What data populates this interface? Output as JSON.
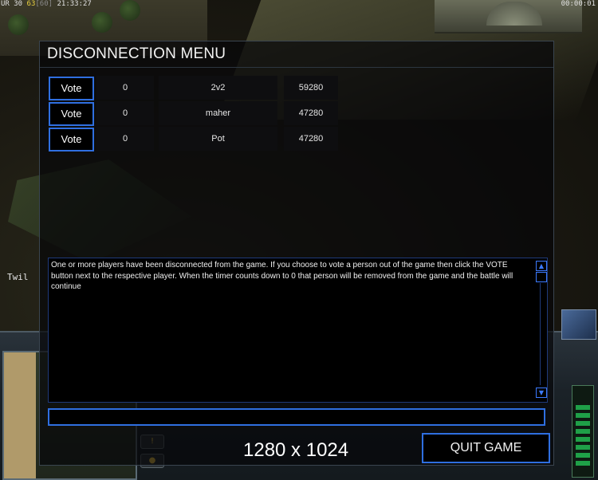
{
  "hud": {
    "ur_label": "UR",
    "ur_value": "30",
    "fps": "63",
    "fps_cap": "[60]",
    "clock": "21:33:27",
    "game_timer": "00:00:01"
  },
  "world": {
    "player_label": "Twil"
  },
  "dialog": {
    "title": "DISCONNECTION MENU",
    "vote_label": "Vote",
    "players": [
      {
        "votes": "0",
        "name": "2v2",
        "ping": "59280"
      },
      {
        "votes": "0",
        "name": "maher",
        "ping": "47280"
      },
      {
        "votes": "0",
        "name": "Pot",
        "ping": "47280"
      }
    ],
    "message": "One or more players have been disconnected from the game. If you choose to vote a person out of the game then click the VOTE button next to the respective player. When the timer counts down to 0 that person will be removed from the game and the battle will continue",
    "chat_value": "",
    "quit_label": "QUIT GAME"
  },
  "overlay": {
    "resolution": "1280 x 1024"
  },
  "colors": {
    "accent": "#2f6fe0",
    "dialog_bg": "#000000",
    "text": "#f2f2f2"
  }
}
